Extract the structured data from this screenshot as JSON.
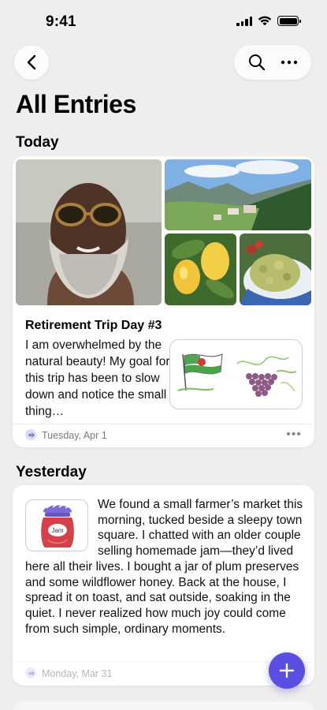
{
  "status_bar": {
    "time": "9:41"
  },
  "nav": {
    "title": "All Entries"
  },
  "sections": {
    "today": "Today",
    "yesterday": "Yesterday"
  },
  "entry1": {
    "title": "Retirement Trip Day #3",
    "body": "I am overwhelmed by the natural beauty! My goal for this trip has been to slow down and notice the small thing…",
    "date": "Tuesday, Apr 1",
    "photos": [
      "portrait-photo",
      "mountain-valley-photo",
      "lemons-photo",
      "pasta-salad-photo"
    ],
    "sketch_label": "flag-and-grapes-sketch"
  },
  "entry2": {
    "body": "We found a small farmer’s market this morning, tucked beside a sleepy town square. I chatted with an older couple selling homemade jam—they’d lived here all their lives. I bought a jar of plum preserves and some wildflower honey. Back at the house, I spread it on toast, and sat outside, soaking in the quiet. I never realized how much joy could come from such simple, ordinary moments.",
    "date": "Monday, Mar 31",
    "sticker_label": "Jam"
  },
  "colors": {
    "accent": "#5a4fe3",
    "background": "#efeded"
  },
  "icons": [
    "back-icon",
    "search-icon",
    "more-icon",
    "airplane-icon",
    "plus-icon"
  ]
}
